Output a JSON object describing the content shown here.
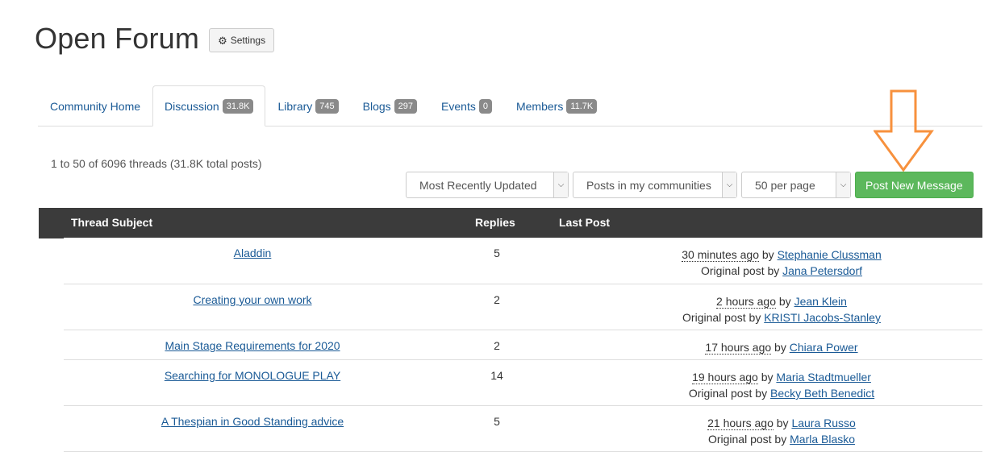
{
  "header": {
    "title": "Open Forum",
    "settings_label": "Settings"
  },
  "tabs": [
    {
      "label": "Community Home",
      "badge": ""
    },
    {
      "label": "Discussion",
      "badge": "31.8K"
    },
    {
      "label": "Library",
      "badge": "745"
    },
    {
      "label": "Blogs",
      "badge": "297"
    },
    {
      "label": "Events",
      "badge": "0"
    },
    {
      "label": "Members",
      "badge": "11.7K"
    }
  ],
  "summary": "1 to 50 of 6096 threads (31.8K total posts)",
  "controls": {
    "sort": "Most Recently Updated",
    "filter": "Posts in my communities",
    "per_page": "50 per page",
    "post_button": "Post New Message"
  },
  "table": {
    "headers": {
      "subject": "Thread Subject",
      "replies": "Replies",
      "last_post": "Last Post"
    },
    "rows": [
      {
        "subject": "Aladdin",
        "replies": "5",
        "ago": "30 minutes ago",
        "by_prefix": " by ",
        "last_author": "Stephanie Clussman",
        "orig_prefix": "Original post by ",
        "orig_author": "Jana Petersdorf"
      },
      {
        "subject": "Creating your own work",
        "replies": "2",
        "ago": "2 hours ago",
        "by_prefix": " by ",
        "last_author": "Jean Klein",
        "orig_prefix": "Original post by ",
        "orig_author": "KRISTI Jacobs-Stanley"
      },
      {
        "subject": "Main Stage Requirements for 2020",
        "replies": "2",
        "ago": "17 hours ago",
        "by_prefix": " by ",
        "last_author": "Chiara Power",
        "orig_prefix": "",
        "orig_author": ""
      },
      {
        "subject": "Searching for MONOLOGUE PLAY",
        "replies": "14",
        "ago": "19 hours ago",
        "by_prefix": " by ",
        "last_author": "Maria Stadtmueller",
        "orig_prefix": "Original post by ",
        "orig_author": "Becky Beth Benedict"
      },
      {
        "subject": "A Thespian in Good Standing advice",
        "replies": "5",
        "ago": "21 hours ago",
        "by_prefix": " by ",
        "last_author": "Laura Russo",
        "orig_prefix": "Original post by ",
        "orig_author": "Marla Blasko"
      }
    ]
  },
  "colors": {
    "accent_green": "#5cb85c",
    "annotation_arrow": "#f7913d",
    "header_bg": "#3b3b3b",
    "link": "#1a5a96"
  }
}
